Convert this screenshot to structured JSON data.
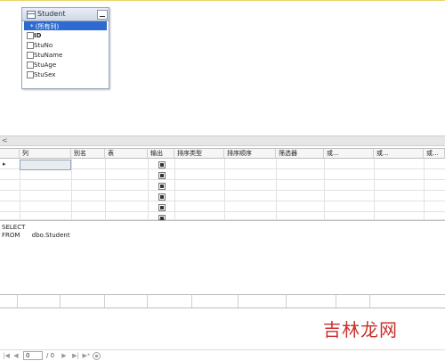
{
  "diagram": {
    "table": {
      "name": "Student",
      "columns": [
        {
          "label": "* (所有列)",
          "selected": true
        },
        {
          "label": "ID",
          "bold": true
        },
        {
          "label": "StuNo"
        },
        {
          "label": "StuName"
        },
        {
          "label": "StuAge"
        },
        {
          "label": "StuSex"
        }
      ]
    }
  },
  "scroll": {
    "left_arrow": "<"
  },
  "criteria": {
    "headers": [
      "列",
      "别名",
      "表",
      "输出",
      "排序类型",
      "排序顺序",
      "筛选器",
      "或...",
      "或...",
      "或..."
    ],
    "row_marker": "▸"
  },
  "sql": {
    "line1": "SELECT",
    "line2": "FROM      dbo.Student"
  },
  "watermark": "吉林龙网",
  "navigator": {
    "first": "|◀",
    "prev": "◀",
    "current_page": "0",
    "of_text": "/ 0",
    "next": "▶",
    "last": "▶|",
    "new": "▶*"
  }
}
